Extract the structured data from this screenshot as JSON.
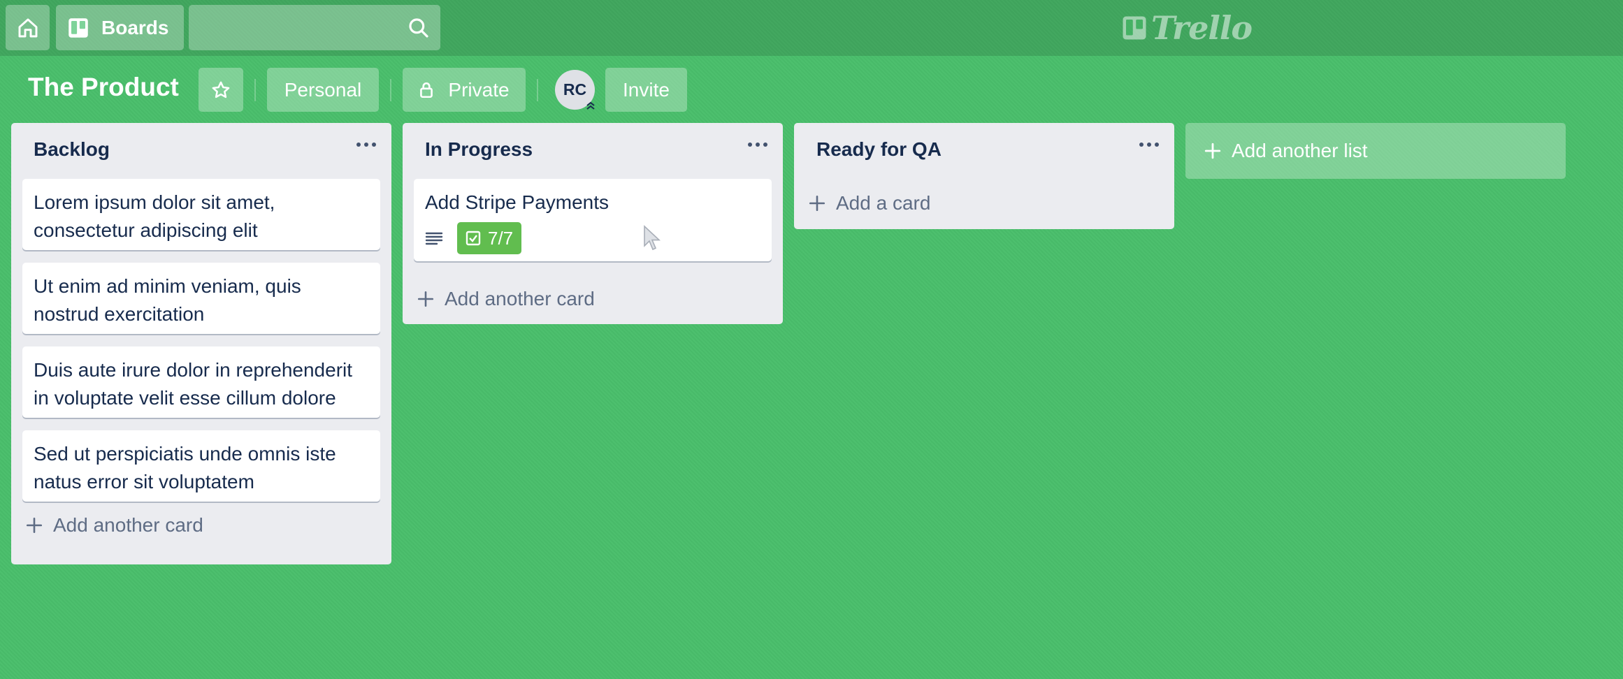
{
  "nav": {
    "home_icon": "home-icon",
    "boards_label": "Boards",
    "search_placeholder": "",
    "logo_text": "Trello"
  },
  "board": {
    "title": "The Product",
    "visibility_team": "Personal",
    "visibility": "Private",
    "member_initials": "RC",
    "invite_label": "Invite"
  },
  "lists": [
    {
      "title": "Backlog",
      "cards": [
        {
          "lines": [
            "Lorem ipsum dolor sit amet,",
            "consectetur adipiscing elit"
          ]
        },
        {
          "lines": [
            "Ut enim ad minim veniam, quis",
            "nostrud exercitation"
          ]
        },
        {
          "lines": [
            "Duis aute irure dolor in reprehenderit",
            "in voluptate velit esse cillum dolore"
          ]
        },
        {
          "lines": [
            "Sed ut perspiciatis unde omnis iste",
            "natus error sit voluptatem"
          ]
        }
      ],
      "add_label": "Add another card"
    },
    {
      "title": "In Progress",
      "cards": [
        {
          "title": "Add Stripe Payments",
          "checklist": "7/7",
          "has_description": true
        }
      ],
      "add_label": "Add another card"
    },
    {
      "title": "Ready for QA",
      "cards": [],
      "add_label": "Add a card"
    }
  ],
  "add_list_label": "Add another list",
  "colors": {
    "background": "#49be6b",
    "list": "#ebecf0",
    "badge_complete": "#61bd4f",
    "text": "#172b4d"
  }
}
